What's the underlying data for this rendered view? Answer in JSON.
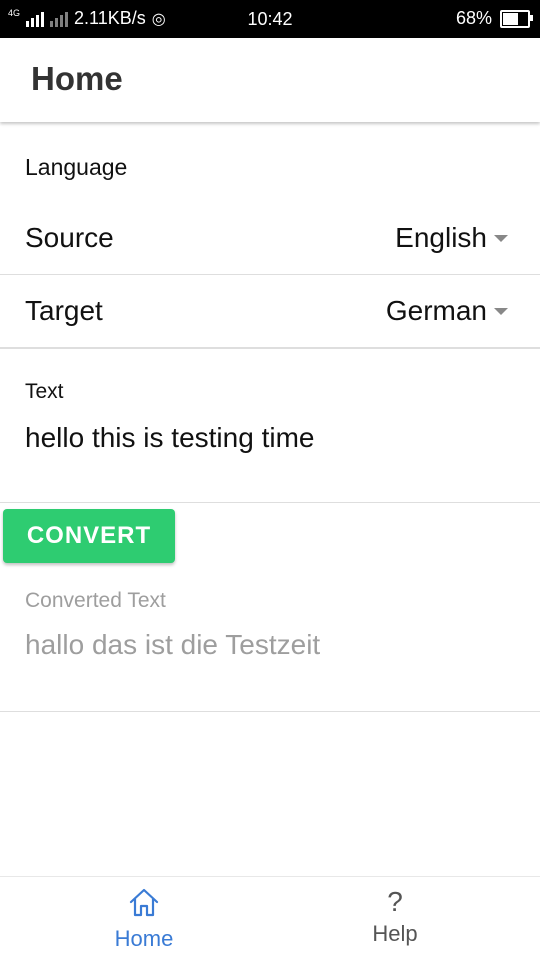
{
  "status_bar": {
    "network": "4G",
    "speed": "2.11KB/s",
    "time": "10:42",
    "battery": "68%",
    "battery_level": 0.68
  },
  "header": {
    "title": "Home"
  },
  "language": {
    "section_label": "Language",
    "source_label": "Source",
    "source_value": "English",
    "target_label": "Target",
    "target_value": "German"
  },
  "text_input": {
    "label": "Text",
    "value": "hello this is testing time"
  },
  "convert_button": {
    "label": "CONVERT"
  },
  "output": {
    "label": "Converted Text",
    "value": "hallo das ist die Testzeit"
  },
  "bottom_nav": {
    "items": [
      {
        "label": "Home",
        "icon": "home-icon",
        "active": true
      },
      {
        "label": "Help",
        "icon": "help-icon",
        "active": false
      }
    ]
  },
  "colors": {
    "accent": "#2ecc71",
    "active_nav": "#3a7bd5",
    "inactive_nav": "#555555",
    "muted_text": "#9e9e9e"
  }
}
